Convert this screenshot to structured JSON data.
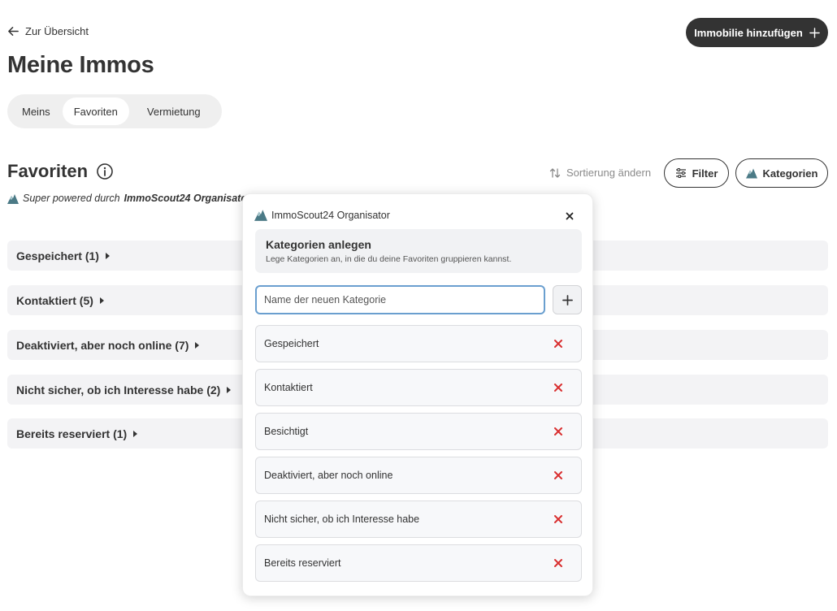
{
  "nav": {
    "back_label": "Zur Übersicht"
  },
  "header": {
    "title": "Meine Immos",
    "add_button_label": "Immobilie hinzufügen"
  },
  "tabs": [
    {
      "label": "Meins",
      "active": false
    },
    {
      "label": "Favoriten",
      "active": true
    },
    {
      "label": "Vermietung",
      "active": false
    }
  ],
  "section": {
    "title": "Favoriten",
    "powered_prefix": "Super powered durch",
    "powered_brand": "ImmoScout24 Organisator"
  },
  "toolbar": {
    "sort_label": "Sortierung ändern",
    "filter_label": "Filter",
    "categories_label": "Kategorien"
  },
  "groups": [
    {
      "label": "Gespeichert (1)"
    },
    {
      "label": "Kontaktiert (5)"
    },
    {
      "label": "Deaktiviert, aber noch online (7)"
    },
    {
      "label": "Nicht sicher, ob ich Interesse habe (2)"
    },
    {
      "label": "Bereits reserviert (1)"
    }
  ],
  "modal": {
    "app_name": "ImmoScout24 Organisator",
    "info_title": "Kategorien anlegen",
    "info_subtitle": "Lege Kategorien an, in die du deine Favoriten gruppieren kannst.",
    "input_placeholder": "Name der neuen Kategorie",
    "input_value": "",
    "categories": [
      {
        "label": "Gespeichert"
      },
      {
        "label": "Kontaktiert"
      },
      {
        "label": "Besichtigt"
      },
      {
        "label": "Deaktiviert, aber noch online"
      },
      {
        "label": "Nicht sicher, ob ich Interesse habe"
      },
      {
        "label": "Bereits reserviert"
      }
    ]
  },
  "colors": {
    "primary_dark": "#333333",
    "delete_red": "#d93030",
    "row_background": "#f3f3f5",
    "focus_border": "#6a9fcf"
  }
}
